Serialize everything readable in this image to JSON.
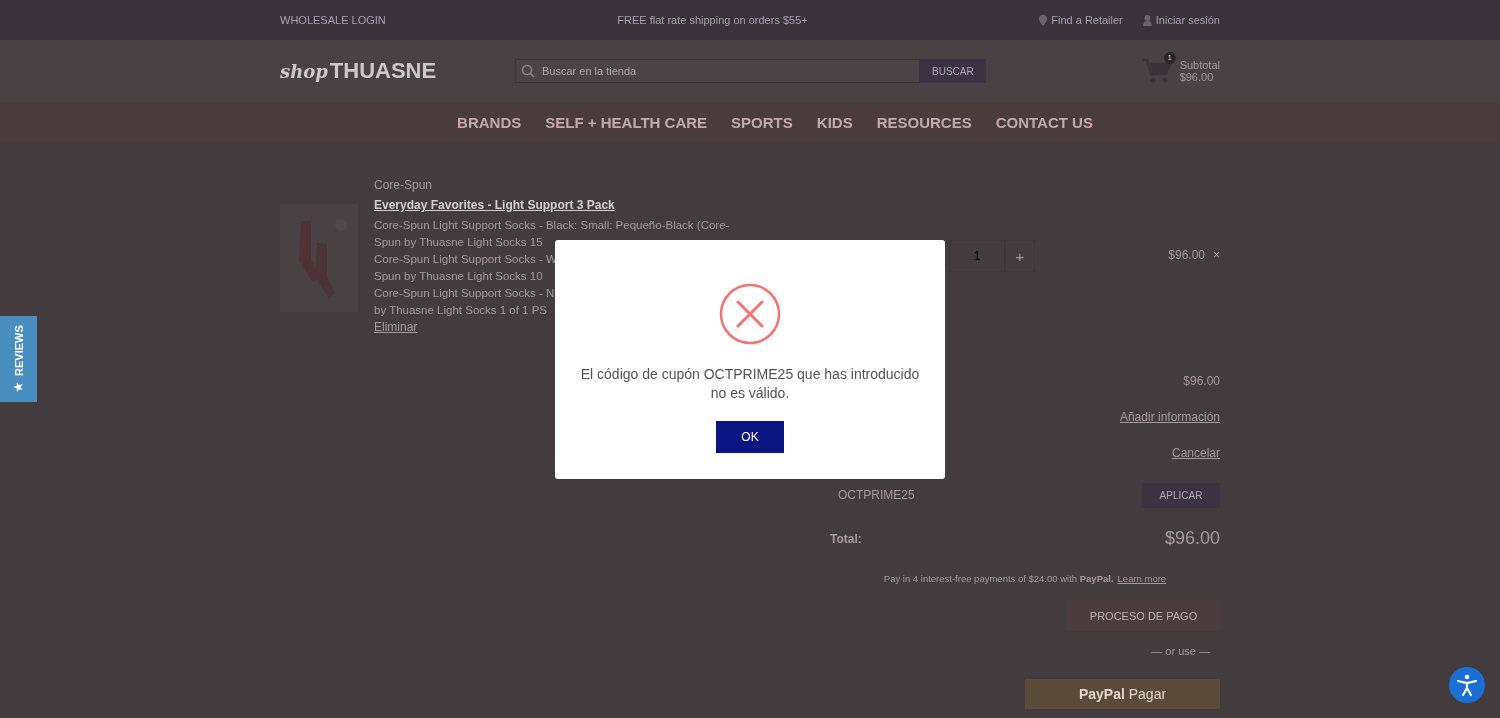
{
  "top_bar": {
    "left_link": "WHOLESALE LOGIN",
    "promo": "FREE flat rate shipping on orders $55+",
    "links": [
      {
        "kind": "pin",
        "label": "Find a Retailer"
      },
      {
        "kind": "user",
        "label": "Iniciar sesión"
      }
    ]
  },
  "header": {
    "logo": {
      "script": "shop",
      "word": "THUASNE"
    },
    "search": {
      "placeholder": "Buscar en la tienda",
      "button": "BUSCAR"
    },
    "cart": {
      "count": "1",
      "lines": [
        "Subtotal",
        "$96.00"
      ]
    }
  },
  "nav": [
    {
      "label": "BRANDS"
    },
    {
      "label": "SELF + HEALTH CARE"
    },
    {
      "label": "SPORTS"
    },
    {
      "label": "KIDS"
    },
    {
      "label": "RESOURCES"
    },
    {
      "label": "CONTACT US"
    }
  ],
  "cart_item": {
    "brand": "Core-Spun",
    "name": "Everyday Favorites - Light Support 3 Pack",
    "description_lines": [
      "Core-Spun Light Support Socks - Black: Small: Pequeño-Black (Core-",
      "Spun by Thuasne Light Socks 15",
      "Core-Spun Light Support Socks - W",
      "Spun by Thuasne Light Socks 10",
      "Core-Spun Light Support Socks - N",
      "by Thuasne Light Socks 1 of 1 PS"
    ],
    "remove": "Eliminar",
    "quantity": "1",
    "plus": "+",
    "price": "$96.00",
    "delete": "×"
  },
  "summary": {
    "subtotal": "$96.00",
    "add_info": "Añadir información",
    "cancel": "Cancelar",
    "coupon_value": "OCTPRIME25",
    "apply": "APLICAR",
    "total_label": "Total:",
    "total": "$96.00",
    "paypal_note": {
      "text": "Pay in 4 interest-free payments of $24.00 with",
      "brand": "PayPal.",
      "link": "Learn more"
    },
    "checkout": "PROCESO DE PAGO",
    "divider": "— or use —",
    "paypal_button": {
      "brand": "PayPal",
      "label": "Pagar"
    }
  },
  "reviews_tab": {
    "star": "★",
    "label": "REVIEWS"
  },
  "modal": {
    "message": "El código de cupón OCTPRIME25 que has introducido no es válido.",
    "ok": "OK"
  }
}
